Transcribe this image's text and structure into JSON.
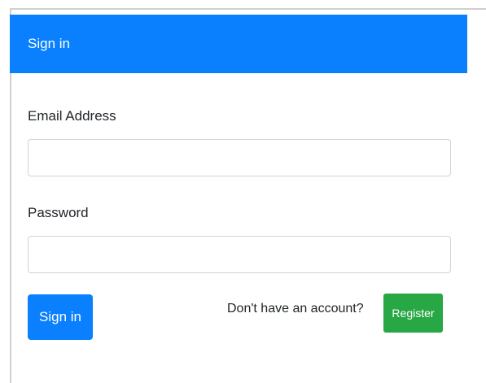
{
  "header": {
    "title": "Sign in"
  },
  "form": {
    "email_label": "Email Address",
    "email_value": "",
    "email_placeholder": "",
    "password_label": "Password",
    "password_value": "",
    "password_placeholder": "",
    "submit_label": "Sign in"
  },
  "footer": {
    "no_account_text": "Don't have an account?",
    "register_label": "Register"
  },
  "colors": {
    "primary": "#0a80ff",
    "success": "#28a745",
    "border": "#ced4da"
  }
}
